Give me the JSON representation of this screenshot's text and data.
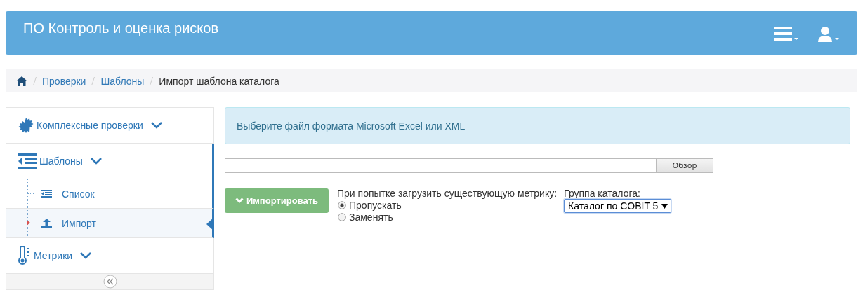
{
  "header": {
    "title": "ПО Контроль и оценка рисков"
  },
  "breadcrumb": [
    {
      "kind": "home"
    },
    {
      "kind": "link",
      "label": "Проверки"
    },
    {
      "kind": "link",
      "label": "Шаблоны"
    },
    {
      "kind": "current",
      "label": "Импорт шаблона каталога"
    }
  ],
  "sidebar": {
    "items": [
      {
        "label": "Комплексные проверки",
        "expanded": false
      },
      {
        "label": "Шаблоны",
        "expanded": true,
        "children": [
          {
            "label": "Список",
            "selected": false
          },
          {
            "label": "Импорт",
            "selected": true
          }
        ]
      },
      {
        "label": "Метрики",
        "expanded": false
      }
    ]
  },
  "alert": {
    "text": "Выберите файл формата Microsoft Excel или XML"
  },
  "file_input": {
    "button": "Обзор"
  },
  "import_button": {
    "label": "Импортировать",
    "disabled": true
  },
  "existing_metric": {
    "label": "При попытке загрузить существующую метрику:",
    "options": [
      {
        "label": "Пропускать",
        "selected": true
      },
      {
        "label": "Заменять",
        "selected": false
      }
    ]
  },
  "catalog_group": {
    "label": "Группа каталога:",
    "value": "Каталог по COBIT 5"
  }
}
